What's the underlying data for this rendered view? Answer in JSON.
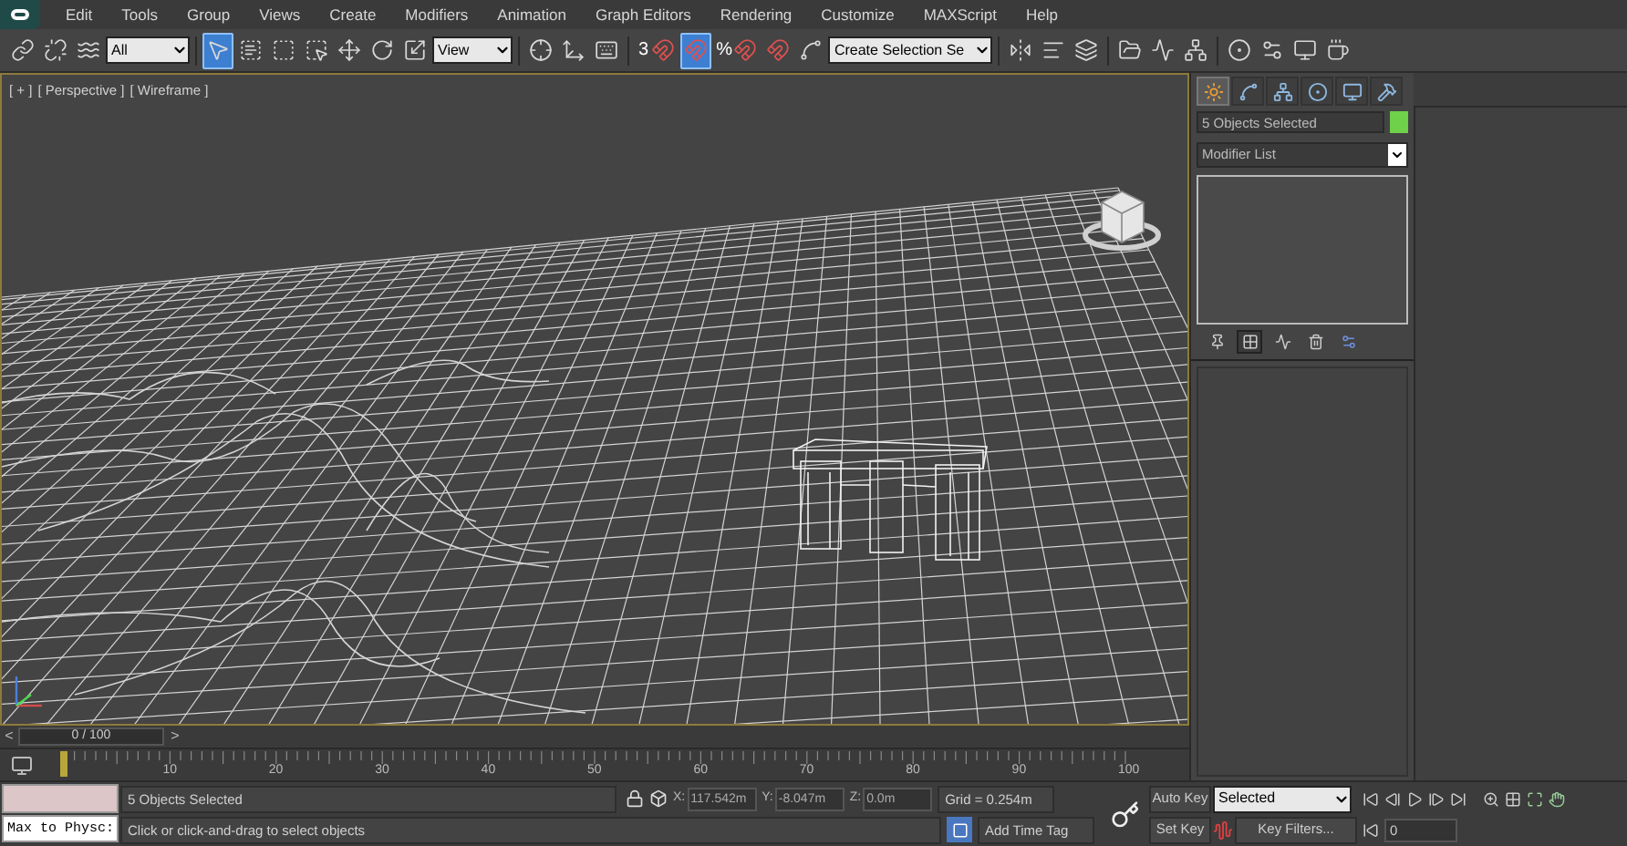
{
  "menu": [
    "Edit",
    "Tools",
    "Group",
    "Views",
    "Create",
    "Modifiers",
    "Animation",
    "Graph Editors",
    "Rendering",
    "Customize",
    "MAXScript",
    "Help"
  ],
  "toolbar": {
    "selection_filter": "All",
    "reference_coordinate": "View",
    "named_selection": "Create Selection Se",
    "tools": [
      {
        "selected": false
      },
      {
        "selected": false
      },
      {
        "selected": false
      },
      {
        "selected": true
      },
      {
        "selected": false
      },
      {
        "selected": false
      },
      {
        "selected": false
      },
      {
        "selected": false
      },
      {
        "selected": false
      },
      {
        "selected": false
      },
      {
        "selected": false
      },
      {
        "selected": false
      },
      {
        "selected": false
      },
      {
        "label": "3",
        "selected": false
      },
      {
        "selected": true
      },
      {
        "label": "%",
        "selected": false
      },
      {
        "selected": false
      },
      {
        "selected": false
      },
      {
        "selected": false
      },
      {
        "selected": false
      },
      {
        "selected": false
      },
      {
        "selected": false
      },
      {
        "selected": false
      },
      {
        "selected": false
      },
      {
        "selected": false
      },
      {
        "selected": false
      },
      {
        "selected": false
      },
      {
        "selected": false
      }
    ]
  },
  "viewport": {
    "labels": [
      "[ + ]",
      "[ Perspective ]",
      "[ Wireframe ]"
    ]
  },
  "command_panel": {
    "tabs": [
      {
        "selected": true
      },
      {
        "selected": false
      },
      {
        "selected": false
      },
      {
        "selected": false
      },
      {
        "selected": false
      },
      {
        "selected": false
      }
    ],
    "object_name": "5 Objects Selected",
    "object_swatch": {
      "color": "#6fd04a"
    },
    "modifier_list": "Modifier List",
    "stack_buttons": [
      {
        "selected": false
      },
      {
        "selected": true
      },
      {
        "selected": false
      },
      {
        "selected": false
      },
      {
        "selected": false
      }
    ]
  },
  "time_slider": {
    "prev": "<",
    "label": "0 / 100",
    "next": ">",
    "level": 0
  },
  "track_bar": {
    "ticks": [
      "10",
      "20",
      "30",
      "40",
      "50",
      "60",
      "70",
      "80",
      "90",
      "100"
    ]
  },
  "status_bar": {
    "listener": "Max to Physc:",
    "selection_info": "5 Objects Selected",
    "prompt": "Click or click-and-drag to select objects",
    "coordinates": [
      {
        "axis": "X:",
        "value": "117.542m"
      },
      {
        "axis": "Y:",
        "value": "-8.047m"
      },
      {
        "axis": "Z:",
        "value": "0.0m"
      }
    ],
    "grid": "Grid = 0.254m",
    "add_time_tag": "Add Time Tag"
  },
  "animation_controls": {
    "auto_key": "Auto Key",
    "auto_key_on": false,
    "key_mode": "Selected",
    "set_key": "Set Key",
    "key_filters": "Key Filters...",
    "current_frame": "0"
  }
}
